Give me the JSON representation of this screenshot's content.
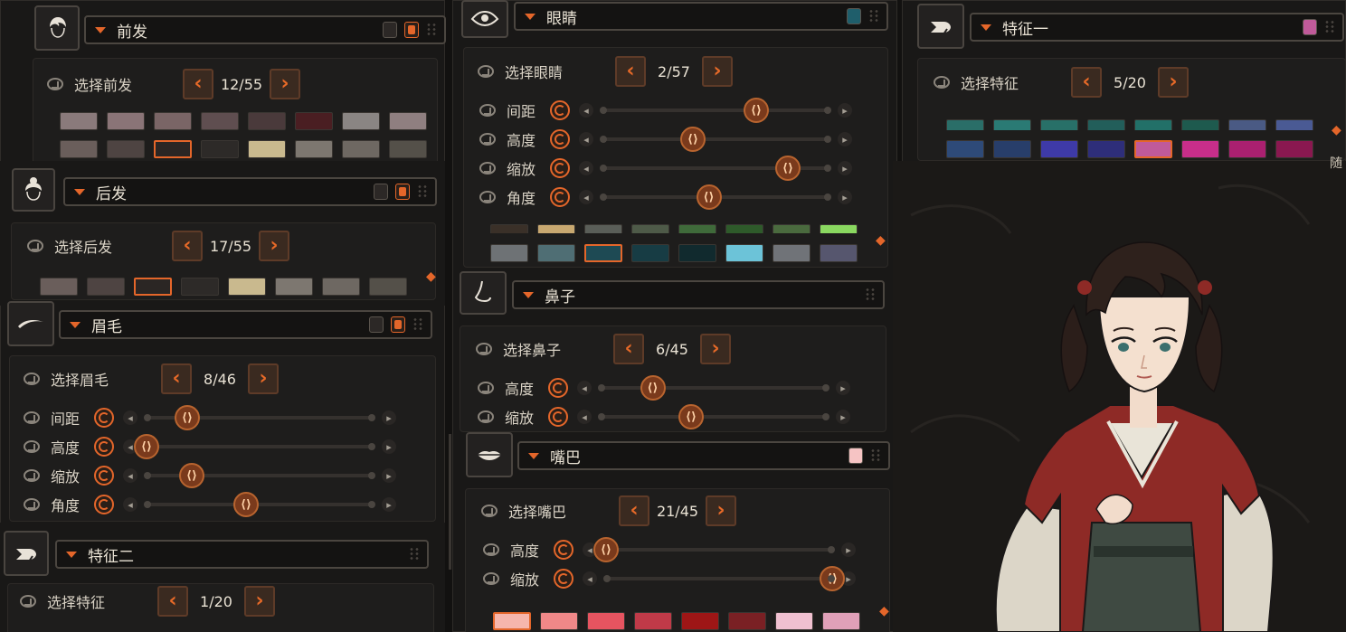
{
  "bangs": {
    "title": "前发",
    "select_label": "选择前发",
    "count": "12/55",
    "colors_row1": [
      "#8a7a7b",
      "#8a7477",
      "#7a6566",
      "#5f4e50",
      "#4a3a3b",
      "#4a1e22",
      "#8a8583",
      "#8f7f80"
    ],
    "colors_row2": [
      "#6a5e5b",
      "#4e4442",
      "#2b2624",
      "#2d2a28",
      "#c9b98e",
      "#7d7770",
      "#6e6862",
      "#545049"
    ]
  },
  "back_hair": {
    "title": "后发",
    "select_label": "选择后发",
    "count": "17/55",
    "colors": [
      "#6a5e5b",
      "#4e4442",
      "#2b2624",
      "#2d2a28",
      "#c9b98e",
      "#7d7770",
      "#6e6862",
      "#545049"
    ]
  },
  "brows": {
    "title": "眉毛",
    "select_label": "选择眉毛",
    "count": "8/46",
    "sliders": [
      {
        "label": "间距",
        "value": 0.18
      },
      {
        "label": "高度",
        "value": 0.0
      },
      {
        "label": "缩放",
        "value": 0.2
      },
      {
        "label": "角度",
        "value": 0.44
      }
    ]
  },
  "feature2": {
    "title": "特征二",
    "select_label": "选择特征",
    "count": "1/20"
  },
  "eyes": {
    "title": "眼睛",
    "select_label": "选择眼睛",
    "count": "2/57",
    "header_color": "#1f5e6b",
    "sliders": [
      {
        "label": "间距",
        "value": 0.68
      },
      {
        "label": "高度",
        "value": 0.4
      },
      {
        "label": "缩放",
        "value": 0.82
      },
      {
        "label": "角度",
        "value": 0.47
      }
    ],
    "colors": [
      "#6e7275",
      "#4f6e74",
      "#1e4a54",
      "#173c44",
      "#112a2e",
      "#6cc3d8",
      "#707378",
      "#56566e"
    ],
    "colors_top": [
      "#3a3028",
      "#c8a870",
      "#5a5e58",
      "#4e5a48",
      "#3f6a3a",
      "#2e5a2a",
      "#4a6a3e",
      "#8ad860"
    ]
  },
  "nose": {
    "title": "鼻子",
    "select_label": "选择鼻子",
    "count": "6/45",
    "sliders": [
      {
        "label": "高度",
        "value": 0.23
      },
      {
        "label": "缩放",
        "value": 0.4
      }
    ]
  },
  "mouth": {
    "title": "嘴巴",
    "select_label": "选择嘴巴",
    "count": "21/45",
    "header_color": "#f6c4c4",
    "sliders": [
      {
        "label": "高度",
        "value": 0.0
      },
      {
        "label": "缩放",
        "value": 1.0
      }
    ],
    "colors": [
      "#f6b6ac",
      "#f08888",
      "#e65460",
      "#c03a48",
      "#9e1616",
      "#7a2024",
      "#f0c0d0",
      "#e0a0b8"
    ]
  },
  "feature1": {
    "title": "特征一",
    "select_label": "选择特征",
    "count": "5/20",
    "header_color": "#c05a9a",
    "colors_top": [
      "#2a6e68",
      "#2a7a74",
      "#287068",
      "#225e5a",
      "#227068",
      "#1e5a4e",
      "#4a5a84",
      "#4a5a94"
    ],
    "colors": [
      "#2e4a78",
      "#283e6a",
      "#3e3aa8",
      "#2e2e7a",
      "#c05a9a",
      "#c82e8a",
      "#aa2070",
      "#8a1850"
    ]
  },
  "portrait_edge_text": "随"
}
